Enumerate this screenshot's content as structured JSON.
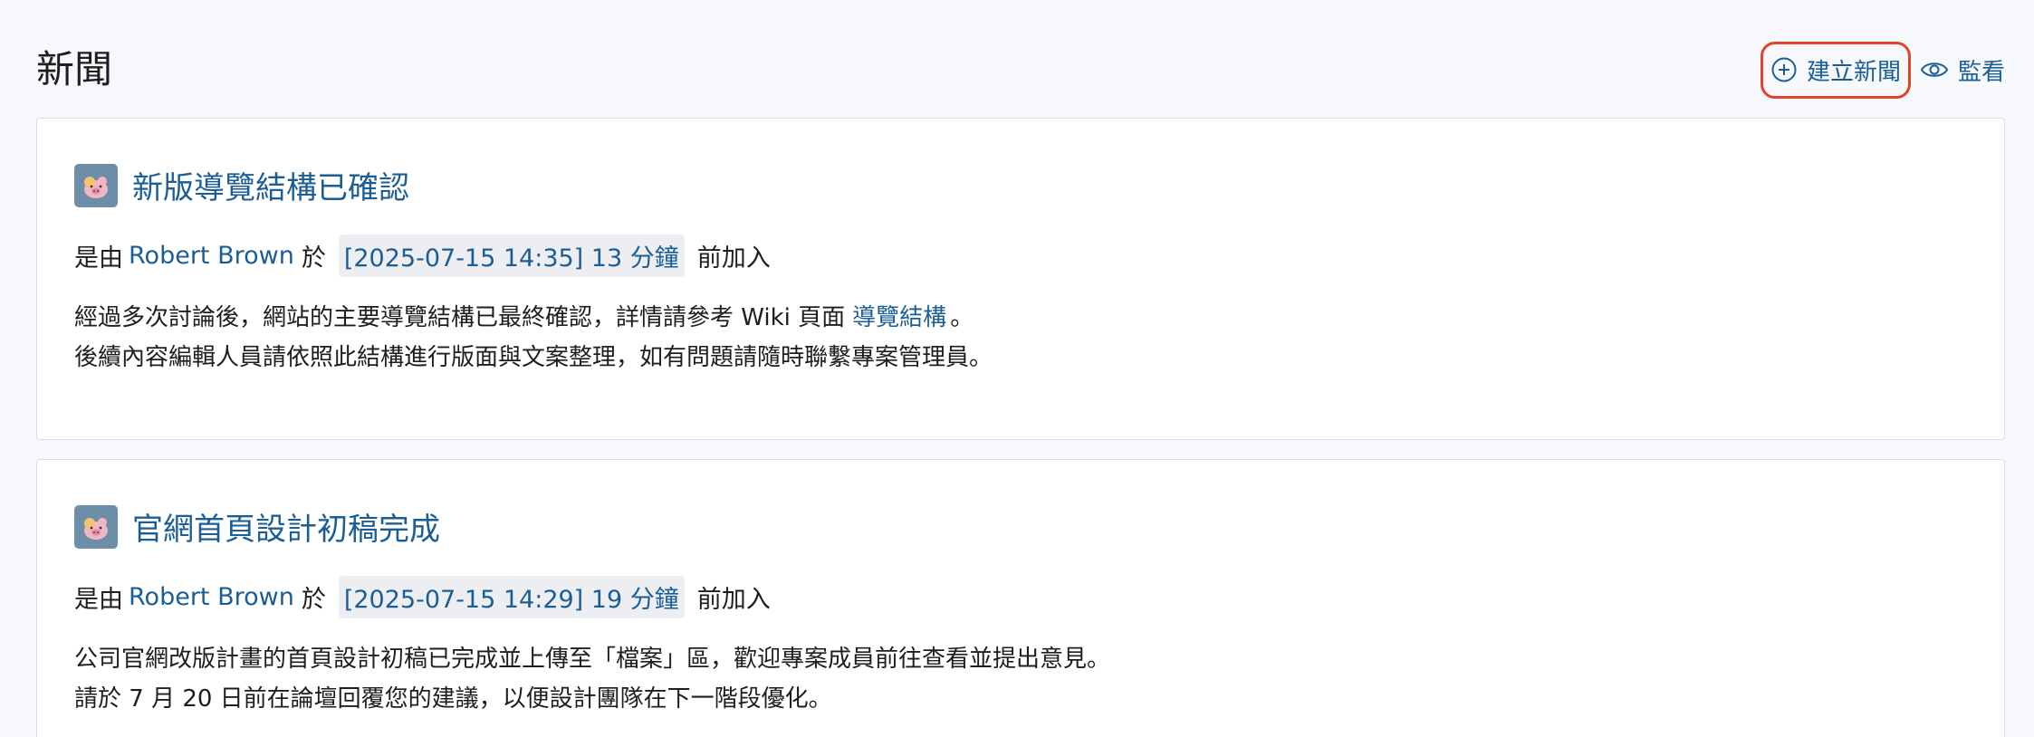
{
  "page": {
    "title": "新聞"
  },
  "actions": {
    "create_label": "建立新聞",
    "watch_label": "監看"
  },
  "news": [
    {
      "title": "新版導覽結構已確認",
      "meta_prefix": "是由",
      "author": "Robert Brown",
      "meta_middle": "於",
      "timestamp": "[2025-07-15 14:35] 13 分鐘",
      "meta_suffix": "前加入",
      "line1_before": "經過多次討論後，網站的主要導覽結構已最終確認，詳情請參考 Wiki 頁面",
      "line1_link": "導覽結構",
      "line1_after": "。",
      "line2": "後續內容編輯人員請依照此結構進行版面與文案整理，如有問題請隨時聯繫專案管理員。"
    },
    {
      "title": "官網首頁設計初稿完成",
      "meta_prefix": "是由",
      "author": "Robert Brown",
      "meta_middle": "於",
      "timestamp": "[2025-07-15 14:29] 19 分鐘",
      "meta_suffix": "前加入",
      "line1": "公司官網改版計畫的首頁設計初稿已完成並上傳至「檔案」區，歡迎專案成員前往查看並提出意見。",
      "line2": "請於 7 月 20 日前在論壇回覆您的建議，以便設計團隊在下一階段優化。"
    }
  ],
  "colors": {
    "link": "#1b5e96",
    "highlight_border": "#e0442a",
    "background": "#f6f8fc"
  },
  "icons": {
    "create": "plus-circle-icon",
    "watch": "eye-icon",
    "avatar": "pig-avatar-icon"
  }
}
